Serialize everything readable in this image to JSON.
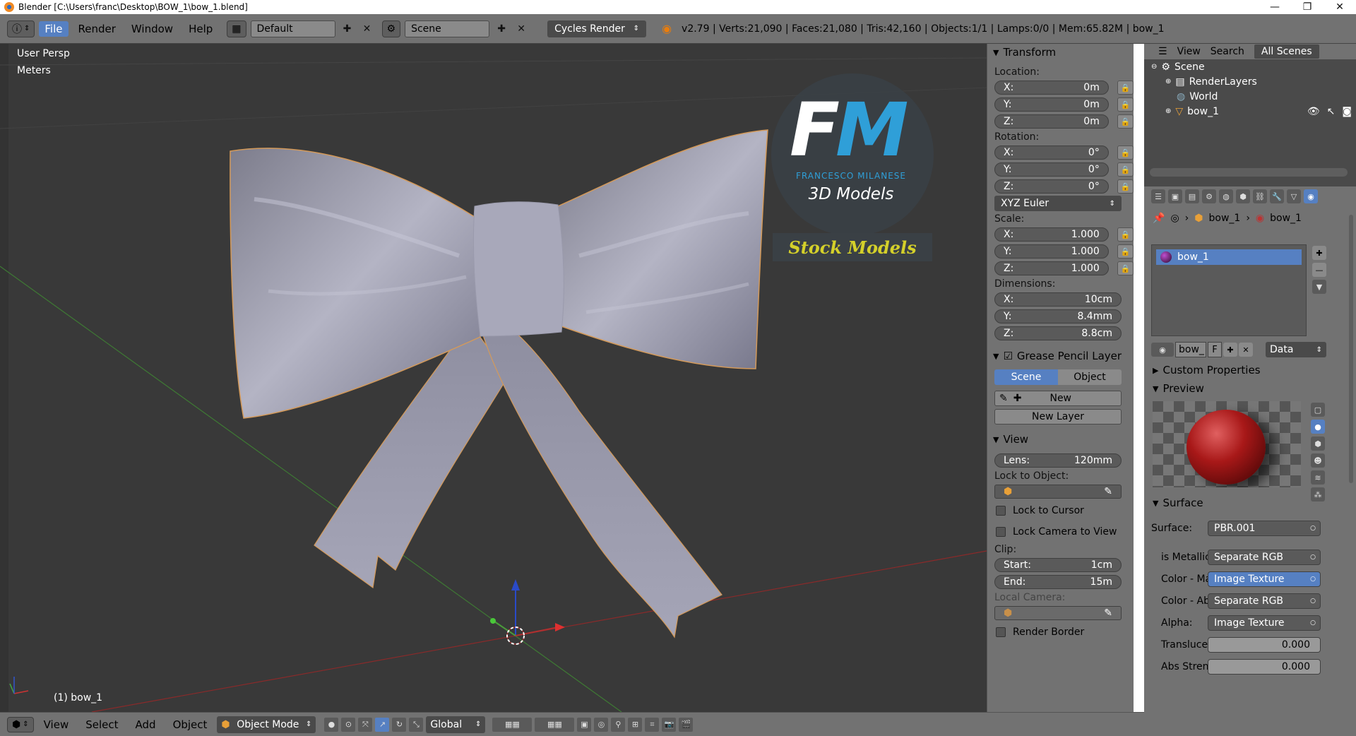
{
  "window": {
    "title": "Blender [C:\\Users\\franc\\Desktop\\BOW_1\\bow_1.blend]",
    "minimize": "—",
    "maximize": "❐",
    "close": "✕"
  },
  "info_header": {
    "menus": [
      "File",
      "Render",
      "Window",
      "Help"
    ],
    "active_menu": "File",
    "screen_layout": "Default",
    "scene": "Scene",
    "render_engine": "Cycles Render",
    "stats": "v2.79 | Verts:21,090 | Faces:21,080 | Tris:42,160 | Objects:1/1 | Lamps:0/0 | Mem:65.82M | bow_1"
  },
  "viewport": {
    "view_name": "User Persp",
    "units": "Meters",
    "object_label": "(1) bow_1",
    "watermark": {
      "logo": "FM",
      "author": "FRANCESCO MILANESE",
      "subtitle": "3D Models",
      "banner": "Stock Models"
    }
  },
  "npanel": {
    "transform": {
      "title": "Transform",
      "location_label": "Location:",
      "location": [
        {
          "axis": "X:",
          "value": "0m"
        },
        {
          "axis": "Y:",
          "value": "0m"
        },
        {
          "axis": "Z:",
          "value": "0m"
        }
      ],
      "rotation_label": "Rotation:",
      "rotation": [
        {
          "axis": "X:",
          "value": "0°"
        },
        {
          "axis": "Y:",
          "value": "0°"
        },
        {
          "axis": "Z:",
          "value": "0°"
        }
      ],
      "rotation_mode": "XYZ Euler",
      "scale_label": "Scale:",
      "scale": [
        {
          "axis": "X:",
          "value": "1.000"
        },
        {
          "axis": "Y:",
          "value": "1.000"
        },
        {
          "axis": "Z:",
          "value": "1.000"
        }
      ],
      "dimensions_label": "Dimensions:",
      "dimensions": [
        {
          "axis": "X:",
          "value": "10cm"
        },
        {
          "axis": "Y:",
          "value": "8.4mm"
        },
        {
          "axis": "Z:",
          "value": "8.8cm"
        }
      ]
    },
    "grease_pencil": {
      "title": "Grease Pencil Layer",
      "tabs": [
        "Scene",
        "Object"
      ],
      "active_tab": "Scene",
      "new_button": "New",
      "new_layer_button": "New Layer"
    },
    "view": {
      "title": "View",
      "lens_label": "Lens:",
      "lens_value": "120mm",
      "lock_to_object": "Lock to Object:",
      "lock_to_cursor": "Lock to Cursor",
      "lock_camera": "Lock Camera to View",
      "clip_label": "Clip:",
      "clip_start_label": "Start:",
      "clip_start": "1cm",
      "clip_end_label": "End:",
      "clip_end": "15m",
      "local_camera": "Local Camera:",
      "render_border": "Render Border"
    }
  },
  "outliner": {
    "menus": [
      "View",
      "Search"
    ],
    "filter": "All Scenes",
    "items": [
      {
        "label": "Scene",
        "level": 0
      },
      {
        "label": "RenderLayers",
        "level": 1
      },
      {
        "label": "World",
        "level": 1
      },
      {
        "label": "bow_1",
        "level": 1
      }
    ]
  },
  "properties": {
    "breadcrumb": [
      "bow_1",
      "bow_1"
    ],
    "material_slot": "bow_1",
    "material_name": "bow_",
    "fake_user": "F",
    "link": "Data",
    "custom_properties": "Custom Properties",
    "preview": "Preview",
    "surface_section": "Surface",
    "surface_label": "Surface:",
    "surface_value": "PBR.001",
    "inputs": [
      {
        "label": "is Metallic",
        "value": "Separate RGB",
        "highlight": false
      },
      {
        "label": "Color - Ma",
        "value": "Image Texture",
        "highlight": true
      },
      {
        "label": "Color - Ab",
        "value": "Separate RGB",
        "highlight": false
      },
      {
        "label": "Alpha:",
        "value": "Image Texture",
        "highlight": false
      }
    ],
    "numeric_inputs": [
      {
        "label": "Transluce",
        "value": "0.000"
      },
      {
        "label": "Abs Stren",
        "value": "0.000"
      }
    ]
  },
  "view3d_header": {
    "menus": [
      "View",
      "Select",
      "Add",
      "Object"
    ],
    "mode": "Object Mode",
    "orientation": "Global"
  },
  "colors": {
    "viewport_bg": "#393939",
    "panel_bg": "#727272",
    "selection_blue": "#5680c2",
    "x_axis": "#b03030",
    "y_axis": "#4a9a3a",
    "z_axis": "#2a4ac8",
    "bow": "#9a9aaa",
    "watermark_blue": "#2f9fd8",
    "banner_yellow": "#d4d02a"
  }
}
